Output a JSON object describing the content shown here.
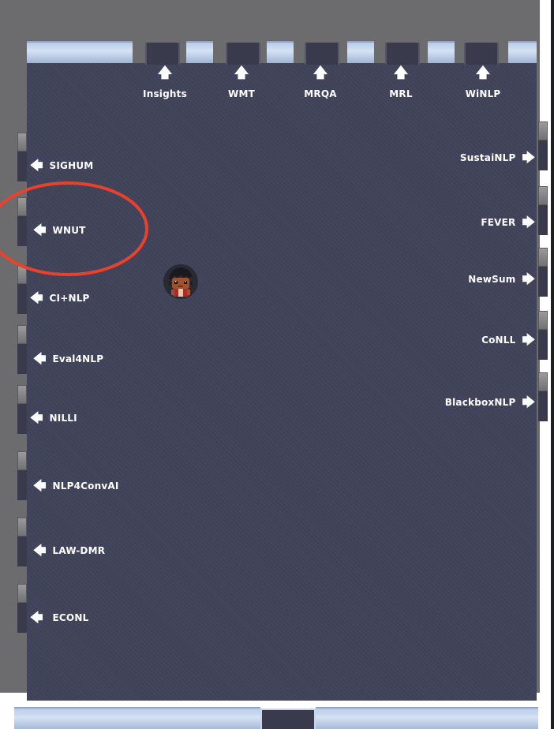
{
  "room": {
    "floor_color": "#3f4258",
    "wall_color": "#6c6c6e",
    "window_color": "#c8d8ee",
    "highlight_color": "#e8412c"
  },
  "exits": {
    "top": [
      {
        "label": "Insights",
        "icon": "arrow-up-icon"
      },
      {
        "label": "WMT",
        "icon": "arrow-up-icon"
      },
      {
        "label": "MRQA",
        "icon": "arrow-up-icon"
      },
      {
        "label": "MRL",
        "icon": "arrow-up-icon"
      },
      {
        "label": "WiNLP",
        "icon": "arrow-up-icon"
      }
    ],
    "left": [
      {
        "label": "SIGHUM",
        "icon": "arrow-left-icon"
      },
      {
        "label": "WNUT",
        "icon": "arrow-left-icon"
      },
      {
        "label": "CI+NLP",
        "icon": "arrow-left-icon"
      },
      {
        "label": "Eval4NLP",
        "icon": "arrow-left-icon"
      },
      {
        "label": "NILLI",
        "icon": "arrow-left-icon"
      },
      {
        "label": "NLP4ConvAI",
        "icon": "arrow-left-icon"
      },
      {
        "label": "LAW-DMR",
        "icon": "arrow-left-icon"
      },
      {
        "label": "ECONL",
        "icon": "arrow-left-icon"
      }
    ],
    "right": [
      {
        "label": "SustaiNLP",
        "icon": "arrow-right-icon"
      },
      {
        "label": "FEVER",
        "icon": "arrow-right-icon"
      },
      {
        "label": "NewSum",
        "icon": "arrow-right-icon"
      },
      {
        "label": "CoNLL",
        "icon": "arrow-right-icon"
      },
      {
        "label": "BlackboxNLP",
        "icon": "arrow-right-icon"
      }
    ]
  },
  "symbols": {
    "up": "🡅",
    "left": "🡄",
    "right": "🡆"
  },
  "highlighted_exit": "WNUT",
  "player": {
    "icon": "player-avatar-icon"
  }
}
